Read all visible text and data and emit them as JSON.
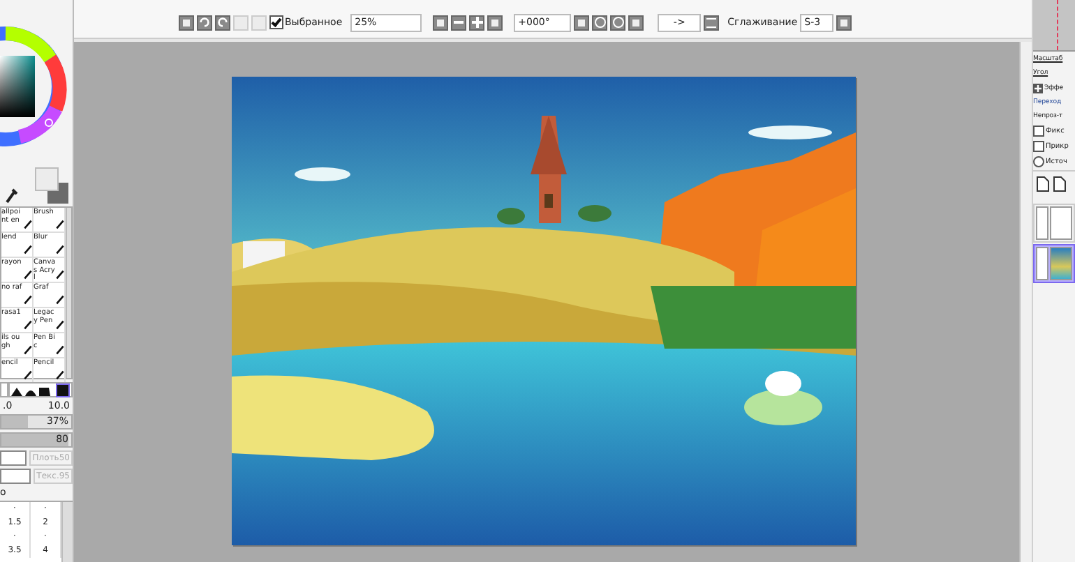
{
  "toolbar": {
    "show_selection": {
      "label": "Выбранное",
      "checked": true
    },
    "zoom": {
      "value": "25%"
    },
    "angle": {
      "value": "+000°"
    },
    "flip": {
      "value": "->"
    },
    "smoothing": {
      "label": "Сглаживание",
      "value": "S-3"
    }
  },
  "tools": [
    {
      "label": "allpoint en",
      "selected": false
    },
    {
      "label": "Brush",
      "selected": false
    },
    {
      "label": "lend",
      "selected": false
    },
    {
      "label": "Blur",
      "selected": false
    },
    {
      "label": "rayon",
      "selected": false
    },
    {
      "label": "Canvas Acryl",
      "selected": false
    },
    {
      "label": "no raf",
      "selected": false
    },
    {
      "label": "Graf",
      "selected": false
    },
    {
      "label": "rasa1",
      "selected": false
    },
    {
      "label": "Legacy Pen",
      "selected": false
    },
    {
      "label": "ils ough",
      "selected": false
    },
    {
      "label": "Pen Bic",
      "selected": false
    },
    {
      "label": "encil",
      "selected": false
    },
    {
      "label": "Pencil",
      "selected": false
    }
  ],
  "brush_settings": {
    "size_min": ".0",
    "size_max": "10.0",
    "density": {
      "value": "37%",
      "level": 0.37
    },
    "opacity": {
      "value": "80",
      "level": 0.95
    },
    "blend": {
      "label": "Плоть",
      "value": "50"
    },
    "texture": {
      "label": "Текс.",
      "value": "95"
    },
    "section_label": "о",
    "size_presets": [
      "·",
      "·",
      "1.5",
      "2",
      "·",
      "·",
      "3.5",
      "4"
    ]
  },
  "navigator": {
    "zoom_label": "Масштаб",
    "angle_label": "Угол"
  },
  "layer_panel": {
    "effects": "Эффе",
    "blend_mode": "Переход",
    "opacity": "Непроз-т",
    "options": [
      {
        "kind": "checkbox",
        "label": "Фикс",
        "checked": false
      },
      {
        "kind": "checkbox",
        "label": "Прикр",
        "checked": false
      },
      {
        "kind": "radio",
        "label": "Источ",
        "checked": false
      }
    ],
    "layers": [
      {
        "selected": false
      },
      {
        "selected": true
      }
    ]
  }
}
